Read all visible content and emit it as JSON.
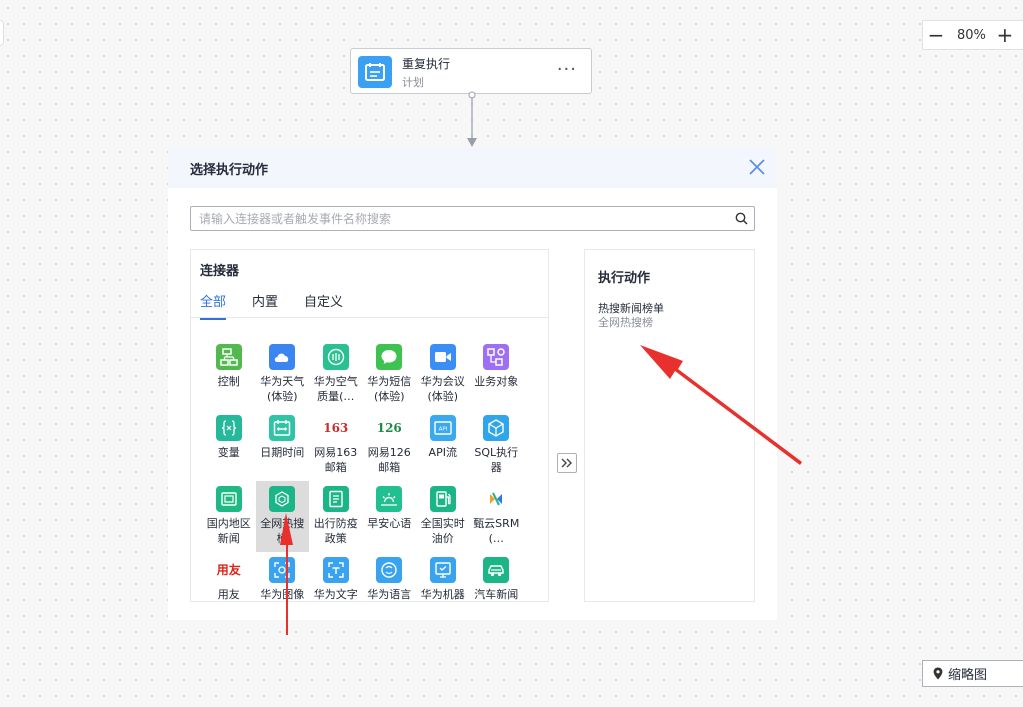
{
  "zoom": {
    "minus": "−",
    "value": "80%",
    "plus": "+"
  },
  "trigger_node": {
    "title": "重复执行",
    "subtitle": "计划",
    "more": "···",
    "icon": "calendar-icon"
  },
  "modal": {
    "title": "选择执行动作",
    "search_placeholder": "请输入连接器或者触发事件名称搜索",
    "connectors": {
      "title": "连接器",
      "tabs": [
        {
          "label": "全部"
        },
        {
          "label": "内置"
        },
        {
          "label": "自定义"
        }
      ],
      "items": [
        {
          "label": "控制",
          "color": "#52b94e",
          "icon": "flow-icon"
        },
        {
          "label": "华为天气(体验)",
          "color": "#3a85f0",
          "icon": "cloud-icon"
        },
        {
          "label": "华为空气质量(…",
          "color": "#29c191",
          "icon": "air-icon"
        },
        {
          "label": "华为短信(体验)",
          "color": "#3fc350",
          "icon": "chat-icon"
        },
        {
          "label": "华为会议(体验)",
          "color": "#3a8ef5",
          "icon": "video-icon"
        },
        {
          "label": "业务对象",
          "color": "#9c6ff5",
          "icon": "object-icon"
        },
        {
          "label": "变量",
          "color": "#26b89a",
          "icon": "variable-icon"
        },
        {
          "label": "日期时间",
          "color": "#30c3a5",
          "icon": "calendar-icon"
        },
        {
          "label": "网易163邮箱",
          "color": "",
          "icon": "netease-163-logo",
          "logo": "163",
          "logo_color": "#c4302b"
        },
        {
          "label": "网易126邮箱",
          "color": "",
          "icon": "netease-126-logo",
          "logo": "126",
          "logo_color": "#1d8a46"
        },
        {
          "label": "API流",
          "color": "#3aa9ee",
          "icon": "api-icon"
        },
        {
          "label": "SQL执行器",
          "color": "#2fa6ea",
          "icon": "cube-icon"
        },
        {
          "label": "国内地区新闻",
          "color": "#1fba84",
          "icon": "news-icon"
        },
        {
          "label": "全网热搜榜",
          "color": "#1cb588",
          "icon": "hexagon-icon",
          "selected": true
        },
        {
          "label": "出行防疫政策",
          "color": "#1cb588",
          "icon": "policy-icon"
        },
        {
          "label": "早安心语",
          "color": "#22bf90",
          "icon": "sunrise-icon"
        },
        {
          "label": "全国实时油价",
          "color": "#1cb588",
          "icon": "fuel-icon"
        },
        {
          "label": "甄云SRM(…",
          "color": "",
          "icon": "srm-logo"
        },
        {
          "label": "用友",
          "color": "",
          "icon": "yonyou-logo",
          "logo": "用友",
          "logo_color": "#d9261c"
        },
        {
          "label": "华为图像",
          "color": "#3aa3ef",
          "icon": "image-icon"
        },
        {
          "label": "华为文字",
          "color": "#3aa3ef",
          "icon": "text-scan-icon"
        },
        {
          "label": "华为语言",
          "color": "#3aa3ef",
          "icon": "language-icon"
        },
        {
          "label": "华为机器",
          "color": "#3aa3ef",
          "icon": "machine-icon"
        },
        {
          "label": "汽车新闻",
          "color": "#1cb588",
          "icon": "car-icon"
        }
      ]
    },
    "transfer_icon": "double-chevron-right-icon",
    "actions": {
      "title": "执行动作",
      "items": [
        {
          "name": "热搜新闻榜单",
          "subtitle": "全网热搜榜"
        }
      ]
    }
  },
  "minimap": {
    "label": "缩略图",
    "icon": "location-pin-icon"
  },
  "annotation_color": "#e8302c"
}
